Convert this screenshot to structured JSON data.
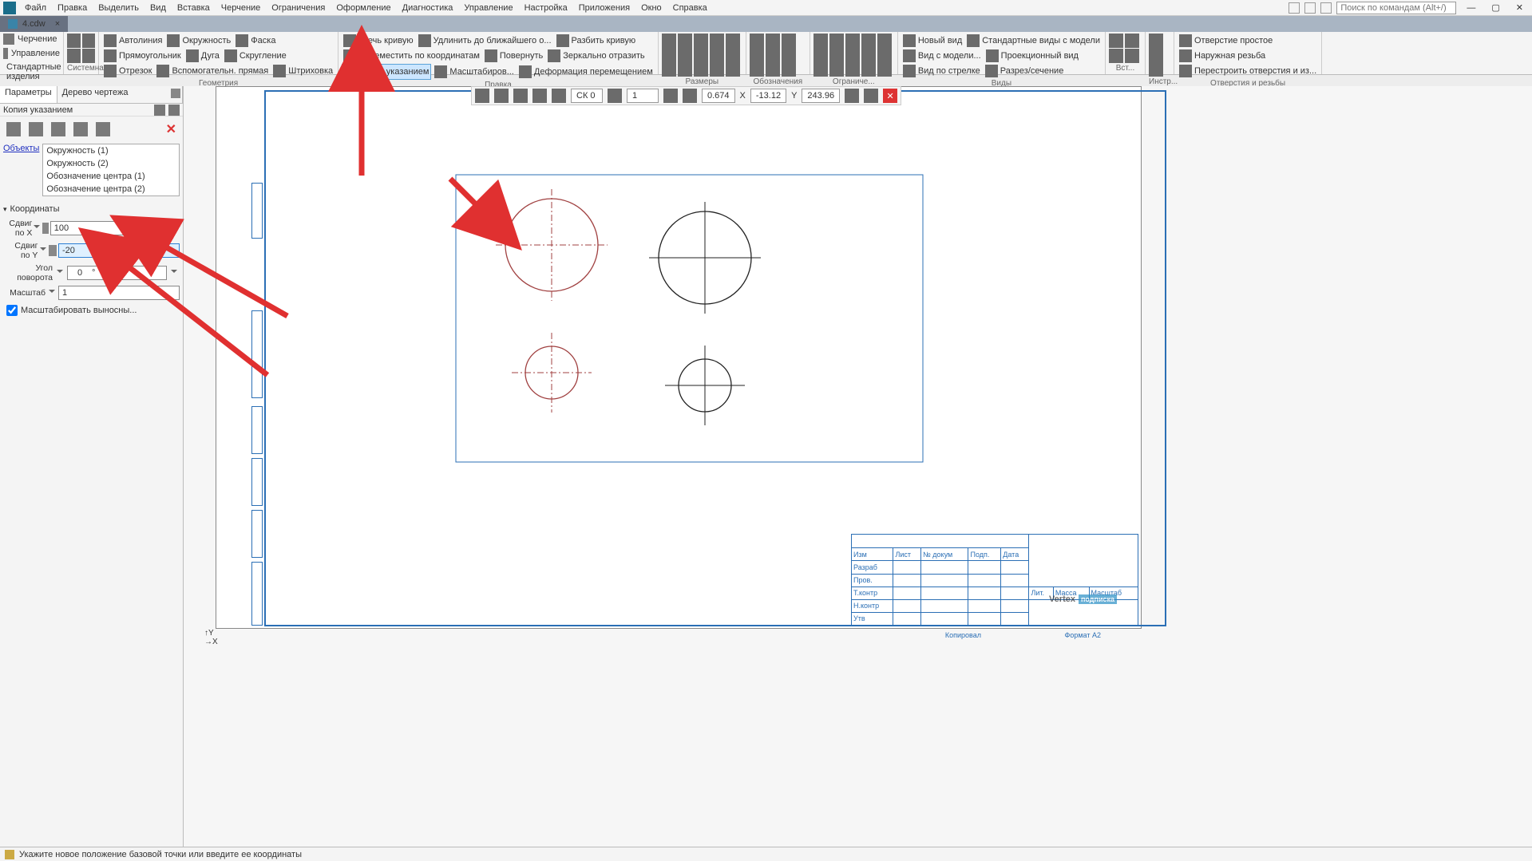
{
  "menu": {
    "items": [
      "Файл",
      "Правка",
      "Выделить",
      "Вид",
      "Вставка",
      "Черчение",
      "Ограничения",
      "Оформление",
      "Диагностика",
      "Управление",
      "Настройка",
      "Приложения",
      "Окно",
      "Справка"
    ],
    "search_ph": "Поиск по командам (Alt+/)"
  },
  "tab": {
    "title": "4.cdw"
  },
  "modes": {
    "drawing": "Черчение",
    "manage": "Управление",
    "std_parts": "Стандартные изделия"
  },
  "ribbon": {
    "system": "Системная",
    "geometry": {
      "title": "Геометрия",
      "autoline": "Автолиния",
      "rect": "Прямоугольник",
      "segment": "Отрезок",
      "circle": "Окружность",
      "arc": "Дуга",
      "aux_line": "Вспомогательн. прямая",
      "chamfer": "Фаска",
      "fillet": "Скругление",
      "hatch": "Штриховка"
    },
    "edit": {
      "title": "Правка",
      "trim": "Усечь кривую",
      "move_coord": "Переместить по координатам",
      "copy_sel": "Копия указанием",
      "extend": "Удлинить до ближайшего о...",
      "rotate": "Повернуть",
      "scale": "Масштабиров...",
      "split": "Разбить кривую",
      "mirror": "Зеркально отразить",
      "deform": "Деформация перемещением"
    },
    "dims": {
      "title": "Размеры"
    },
    "annot": {
      "title": "Обозначения"
    },
    "constr": {
      "title": "Ограниче..."
    },
    "views": {
      "title": "Виды",
      "new_view": "Новый вид",
      "model_view": "Вид с модели...",
      "arrow_view": "Вид по стрелке",
      "std_views": "Стандартные виды с модели",
      "proj_view": "Проекционный вид",
      "section": "Разрез/сечение"
    },
    "insert": {
      "title": "Вст...",
      "tools": "Инстр..."
    },
    "holes": {
      "title": "Отверстия и резьбы",
      "simple": "Отверстие простое",
      "ext_thread": "Наружная резьба",
      "rebuild": "Перестроить отверстия и из..."
    }
  },
  "under": {
    "sys": "Системная",
    "geo": "Геометрия",
    "edit": "Правка"
  },
  "panel": {
    "params": "Параметры",
    "tree": "Дерево чертежа",
    "op_name": "Копия указанием",
    "objects_label": "Объекты",
    "objects": [
      "Окружность (1)",
      "Окружность (2)",
      "Обозначение центра (1)",
      "Обозначение центра (2)"
    ],
    "coords": "Координаты",
    "shift_x": "Сдвиг по X",
    "shift_x_val": "100",
    "shift_y": "Сдвиг по Y",
    "shift_y_val": "-20",
    "angle": "Угол поворота",
    "angle_d": "0",
    "angle_m": "0",
    "scale": "Масштаб",
    "scale_val": "1",
    "chk_scale": "Масштабировать выносны..."
  },
  "ctools": {
    "layer": "СК 0",
    "vnum": "1",
    "zoom": "0.674",
    "x_lbl": "X",
    "x": "-13.12",
    "y_lbl": "Y",
    "y": "243.96"
  },
  "title_block": {
    "r1": [
      "Изм",
      "Лист",
      "№ докум",
      "Подп.",
      "Дата"
    ],
    "r2": "Разраб",
    "r3": "Пров.",
    "r4": "Т.контр",
    "r5": "Н.контр",
    "r6": "Утв",
    "lit": "Лит.",
    "mass": "Масса",
    "scale": "Масштаб",
    "copy": "Копировал",
    "fmt": "Формат  А2"
  },
  "watermark": {
    "text": "Vertex",
    "sub": "подписка"
  },
  "status": {
    "msg": "Укажите новое положение базовой точки или введите ее координаты"
  }
}
